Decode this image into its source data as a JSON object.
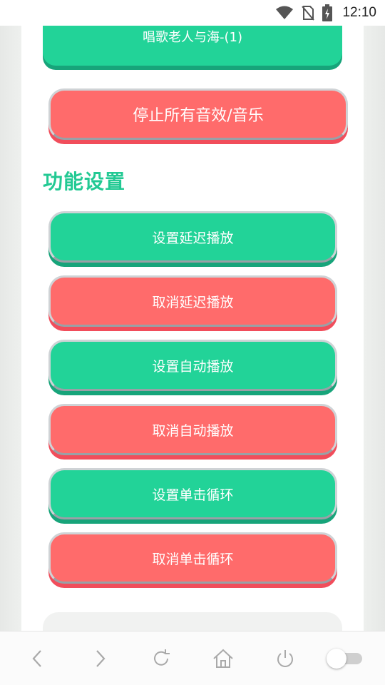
{
  "status_bar": {
    "time": "12:10"
  },
  "buttons": {
    "top_song": "唱歌老人与海-(1)",
    "stop_all": "停止所有音效/音乐"
  },
  "section": {
    "title": "功能设置"
  },
  "functions": {
    "set_delay": "设置延迟播放",
    "cancel_delay": "取消延迟播放",
    "set_auto": "设置自动播放",
    "cancel_auto": "取消自动播放",
    "set_loop": "设置单击循环",
    "cancel_loop": "取消单击循环"
  },
  "colors": {
    "green": "#22d398",
    "red": "#ff6b6b",
    "title_green": "#22c993"
  },
  "nav": {
    "icons": [
      "back-icon",
      "forward-icon",
      "refresh-icon",
      "home-icon",
      "power-icon",
      "toggle-switch"
    ],
    "toggle_on": false
  }
}
